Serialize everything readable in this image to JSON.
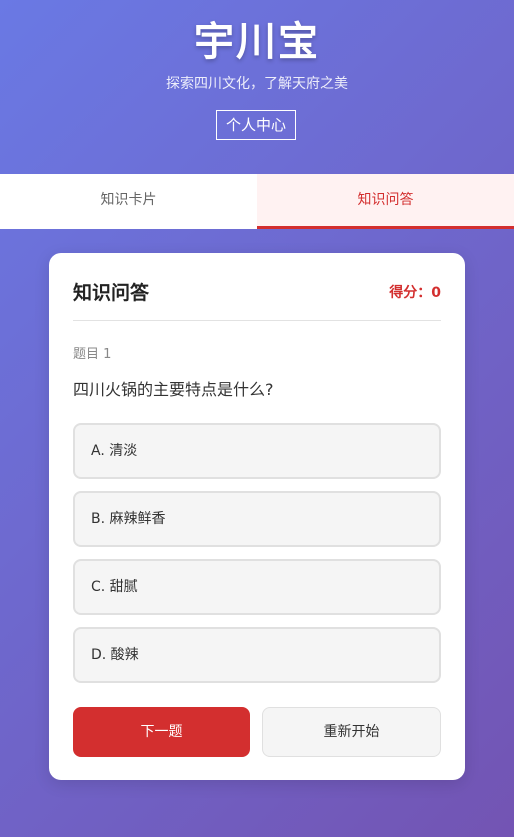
{
  "header": {
    "title": "宇川宝",
    "subtitle": "探索四川文化，了解天府之美",
    "profile_button": "个人中心"
  },
  "tabs": [
    {
      "label": "知识卡片",
      "active": false
    },
    {
      "label": "知识问答",
      "active": true
    }
  ],
  "quiz": {
    "title": "知识问答",
    "score_label": "得分：0",
    "question_number": "题目 1",
    "question": "四川火锅的主要特点是什么?",
    "options": [
      {
        "label": "A. 清淡"
      },
      {
        "label": "B. 麻辣鲜香"
      },
      {
        "label": "C. 甜腻"
      },
      {
        "label": "D. 酸辣"
      }
    ],
    "next_button": "下一题",
    "restart_button": "重新开始"
  },
  "colors": {
    "accent": "#d32f2f",
    "gradient_start": "#6a79e4",
    "gradient_end": "#7354b3"
  }
}
